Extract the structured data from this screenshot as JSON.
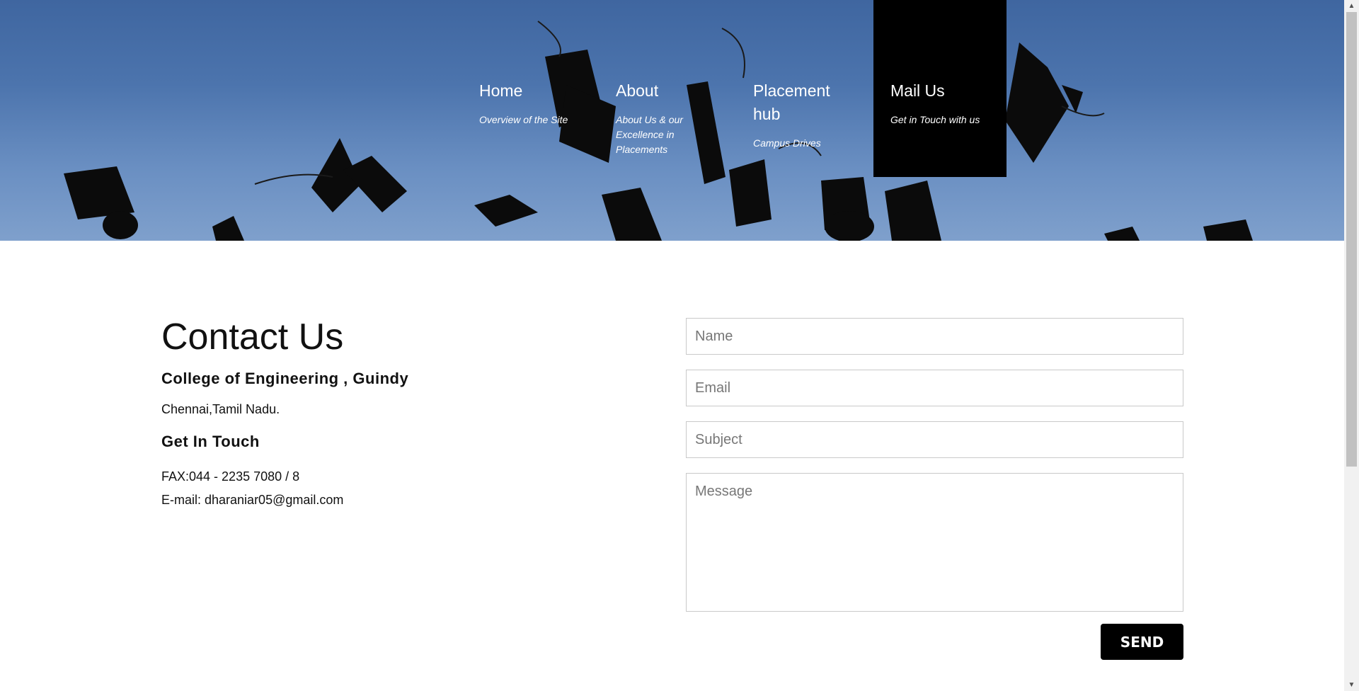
{
  "nav": {
    "items": [
      {
        "title": "Home",
        "subtitle": "Overview of the Site"
      },
      {
        "title": "About",
        "subtitle": "About Us & our Excellence in Placements"
      },
      {
        "title": "Placement hub",
        "subtitle": "Campus Drives"
      },
      {
        "title": "Mail Us",
        "subtitle": "Get in Touch with us",
        "active": true
      }
    ]
  },
  "contact": {
    "title": "Contact Us",
    "college": "College of Engineering , Guindy",
    "city": "Chennai,Tamil Nadu.",
    "touch_heading": "Get In Touch",
    "fax": "FAX:044 - 2235 7080 / 8",
    "email": "E-mail: dharaniar05@gmail.com"
  },
  "form": {
    "name_placeholder": "Name",
    "email_placeholder": "Email",
    "subject_placeholder": "Subject",
    "message_placeholder": "Message",
    "send_label": "SEND"
  },
  "colors": {
    "nav_active_bg": "#000000",
    "sky": "#4c74ad",
    "button_bg": "#000000"
  },
  "icons": {
    "scroll_up": "triangle-up-icon",
    "scroll_down": "triangle-down-icon"
  }
}
